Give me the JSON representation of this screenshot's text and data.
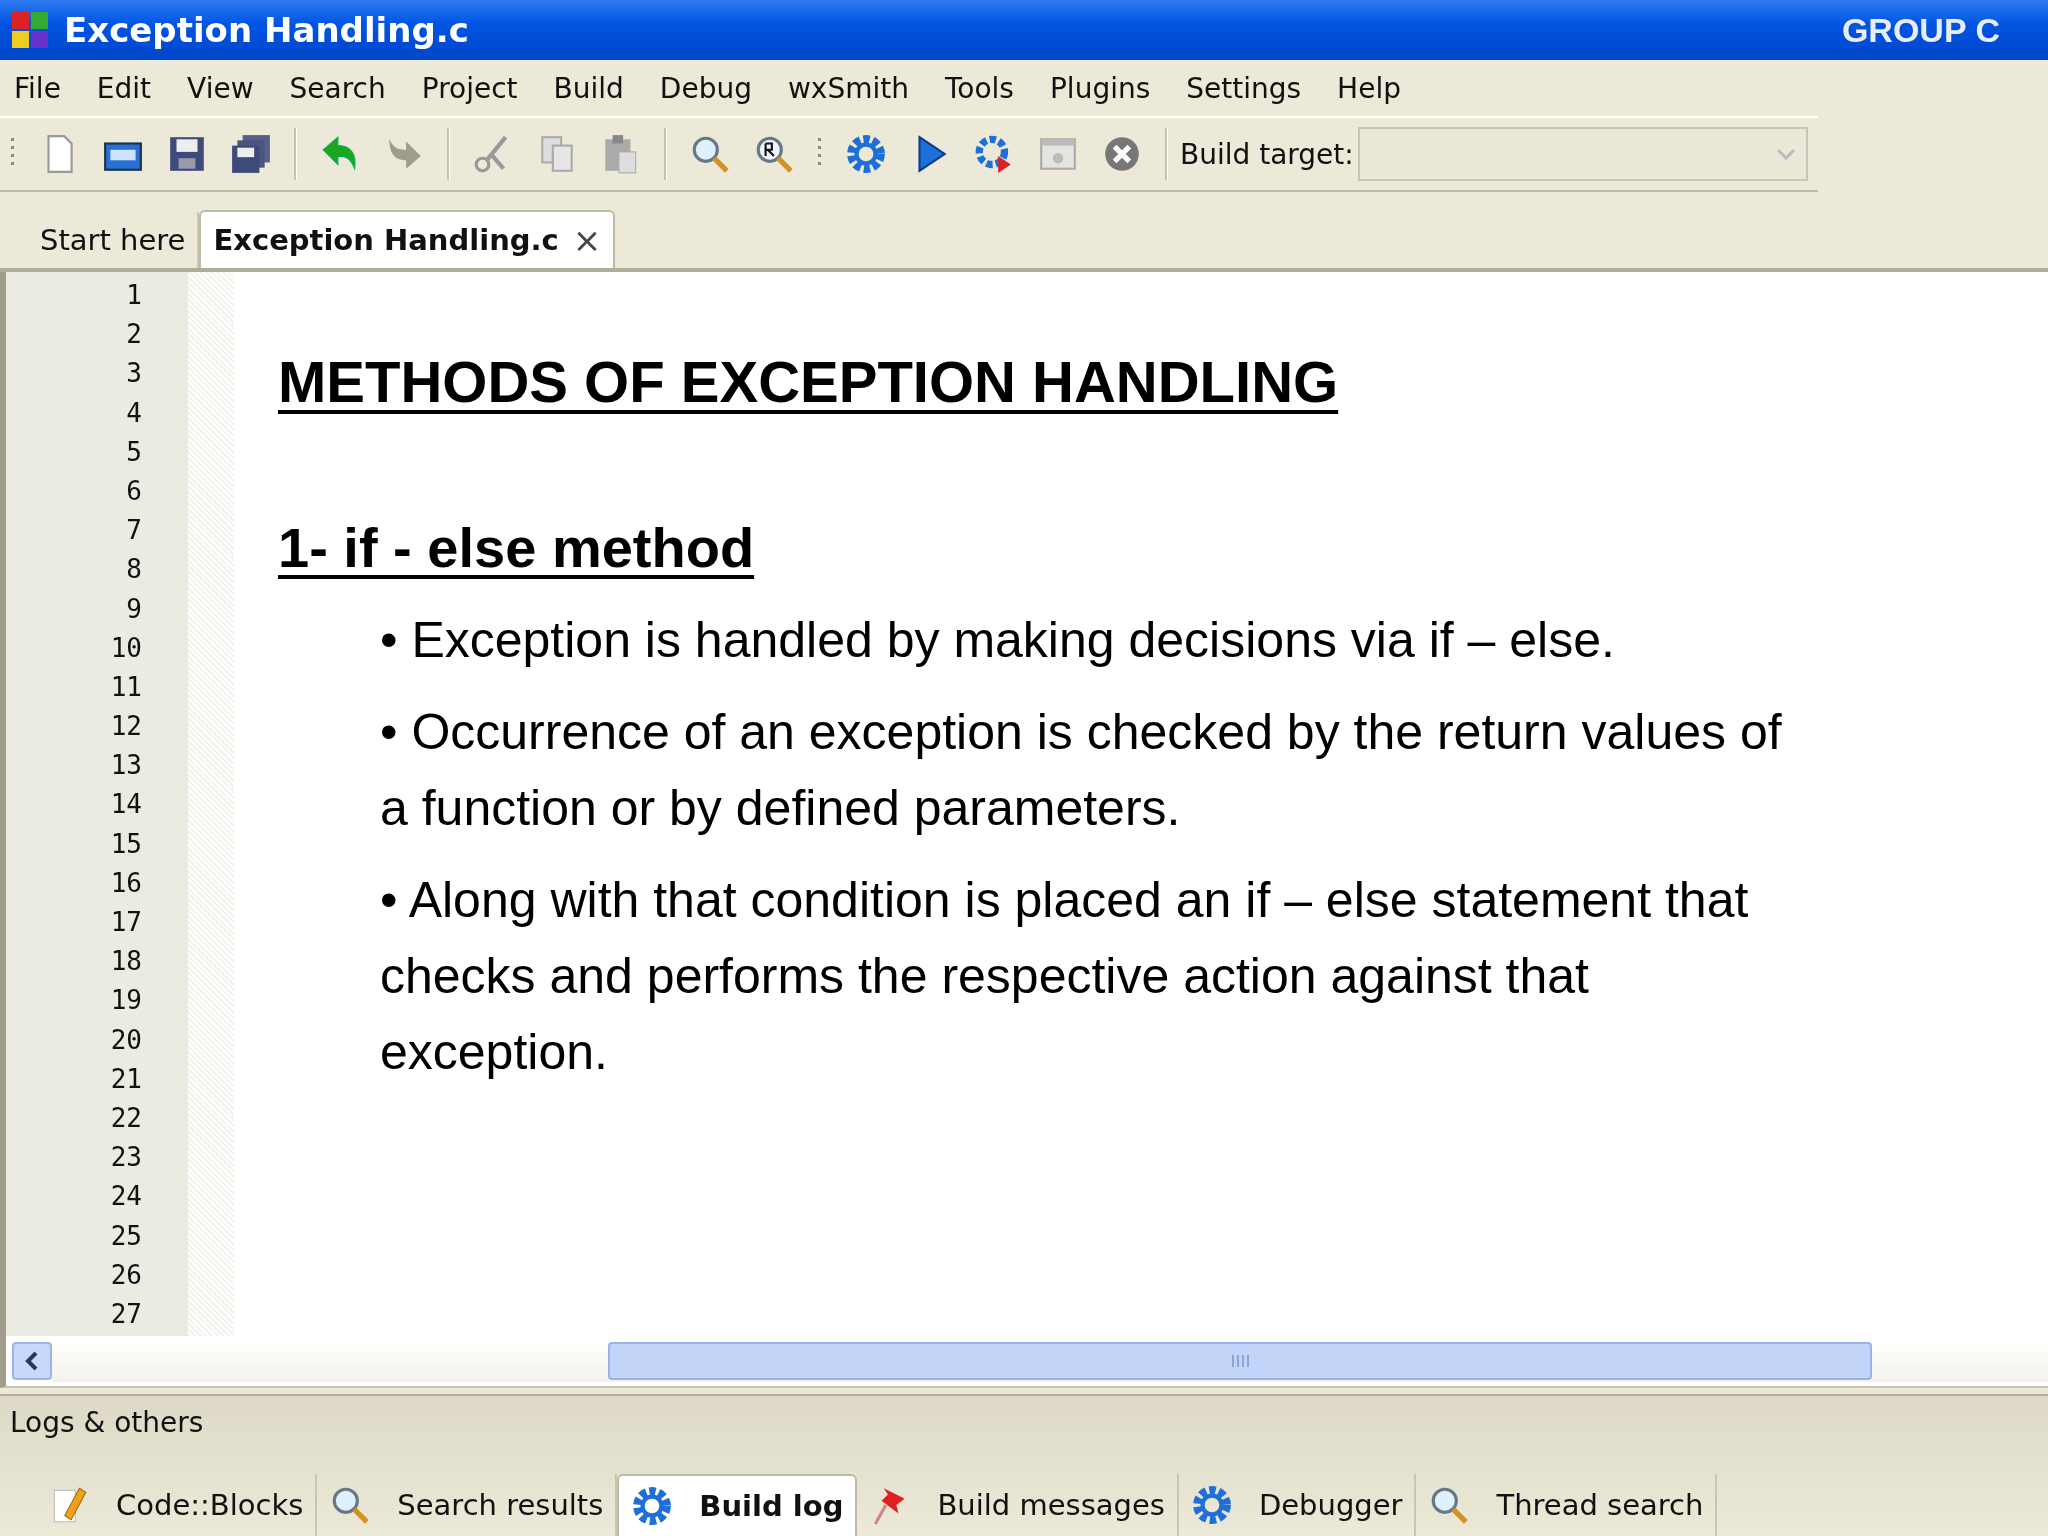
{
  "window": {
    "title": "Exception Handling.c",
    "badge": "GROUP C"
  },
  "menu": [
    "File",
    "Edit",
    "View",
    "Search",
    "Project",
    "Build",
    "Debug",
    "wxSmith",
    "Tools",
    "Plugins",
    "Settings",
    "Help"
  ],
  "toolbar": {
    "build_target_label": "Build target:"
  },
  "editor_tabs": [
    {
      "label": "Start here",
      "selected": false
    },
    {
      "label": "Exception Handling.c",
      "selected": true,
      "close": "×"
    }
  ],
  "line_numbers": [
    "1",
    "2",
    "3",
    "4",
    "5",
    "6",
    "7",
    "8",
    "9",
    "10",
    "11",
    "12",
    "13",
    "14",
    "15",
    "16",
    "17",
    "18",
    "19",
    "20",
    "21",
    "22",
    "23",
    "24",
    "25",
    "26",
    "27"
  ],
  "document": [
    {
      "kind": "heading",
      "text": "METHODS OF EXCEPTION HANDLING"
    },
    {
      "kind": "subheading",
      "text": "1- if - else method"
    },
    {
      "kind": "bullet",
      "text": "• Exception is handled by making decisions via if – else."
    },
    {
      "kind": "bullet",
      "text": "• Occurrence of an exception is checked by the return values of a function or by defined parameters."
    },
    {
      "kind": "bullet",
      "text": "• Along with that condition is placed an if – else statement that checks and performs the respective action against that exception."
    }
  ],
  "bottom_panel": {
    "title": "Logs & others",
    "tabs": [
      {
        "label": "Code::Blocks",
        "selected": false
      },
      {
        "label": "Search results",
        "selected": false
      },
      {
        "label": "Build log",
        "selected": true
      },
      {
        "label": "Build messages",
        "selected": false
      },
      {
        "label": "Debugger",
        "selected": false
      },
      {
        "label": "Thread search",
        "selected": false
      }
    ]
  }
}
